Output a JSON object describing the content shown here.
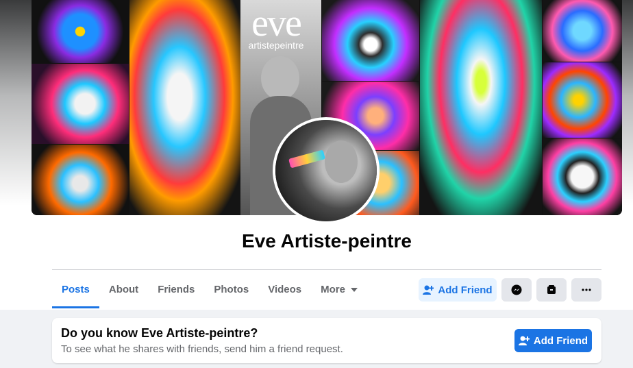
{
  "cover": {
    "brand_title": "eve",
    "brand_subtitle": "artistepeintre"
  },
  "profile": {
    "name": "Eve Artiste-peintre"
  },
  "tabs": [
    {
      "label": "Posts",
      "active": true
    },
    {
      "label": "About",
      "active": false
    },
    {
      "label": "Friends",
      "active": false
    },
    {
      "label": "Photos",
      "active": false
    },
    {
      "label": "Videos",
      "active": false
    },
    {
      "label": "More",
      "active": false
    }
  ],
  "actions": {
    "add_friend_label": "Add Friend",
    "messenger_icon": "messenger-icon",
    "stories_icon": "stories-icon",
    "more_icon": "more-options-icon"
  },
  "prompt_card": {
    "title": "Do you know Eve Artiste-peintre?",
    "subtitle": "To see what he shares with friends, send him a friend request.",
    "button_label": "Add Friend"
  },
  "colors": {
    "accent": "#1b74e4",
    "accent_light": "#e7f3ff",
    "grey_button": "#e4e6eb",
    "page_bg": "#f0f2f5"
  }
}
